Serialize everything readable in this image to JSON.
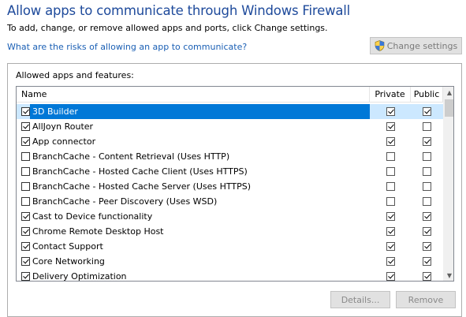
{
  "header": {
    "title": "Allow apps to communicate through Windows Firewall",
    "subtitle": "To add, change, or remove allowed apps and ports, click Change settings.",
    "risk_link": "What are the risks of allowing an app to communicate?",
    "change_settings_label": "Change settings"
  },
  "group": {
    "label": "Allowed apps and features:",
    "columns": {
      "name": "Name",
      "private": "Private",
      "public": "Public"
    },
    "rows": [
      {
        "name": "3D Builder",
        "enabled": true,
        "private": true,
        "public": true,
        "selected": true
      },
      {
        "name": "AllJoyn Router",
        "enabled": true,
        "private": true,
        "public": false
      },
      {
        "name": "App connector",
        "enabled": true,
        "private": true,
        "public": true
      },
      {
        "name": "BranchCache - Content Retrieval (Uses HTTP)",
        "enabled": false,
        "private": false,
        "public": false
      },
      {
        "name": "BranchCache - Hosted Cache Client (Uses HTTPS)",
        "enabled": false,
        "private": false,
        "public": false
      },
      {
        "name": "BranchCache - Hosted Cache Server (Uses HTTPS)",
        "enabled": false,
        "private": false,
        "public": false
      },
      {
        "name": "BranchCache - Peer Discovery (Uses WSD)",
        "enabled": false,
        "private": false,
        "public": false
      },
      {
        "name": "Cast to Device functionality",
        "enabled": true,
        "private": true,
        "public": true
      },
      {
        "name": "Chrome Remote Desktop Host",
        "enabled": true,
        "private": true,
        "public": true
      },
      {
        "name": "Contact Support",
        "enabled": true,
        "private": true,
        "public": true
      },
      {
        "name": "Core Networking",
        "enabled": true,
        "private": true,
        "public": true
      },
      {
        "name": "Delivery Optimization",
        "enabled": true,
        "private": true,
        "public": true
      }
    ],
    "details_label": "Details...",
    "remove_label": "Remove"
  },
  "icons": {
    "change_settings": "uac-shield-icon",
    "scroll_up": "scroll-up-arrow-icon",
    "scroll_down": "scroll-down-arrow-icon"
  }
}
